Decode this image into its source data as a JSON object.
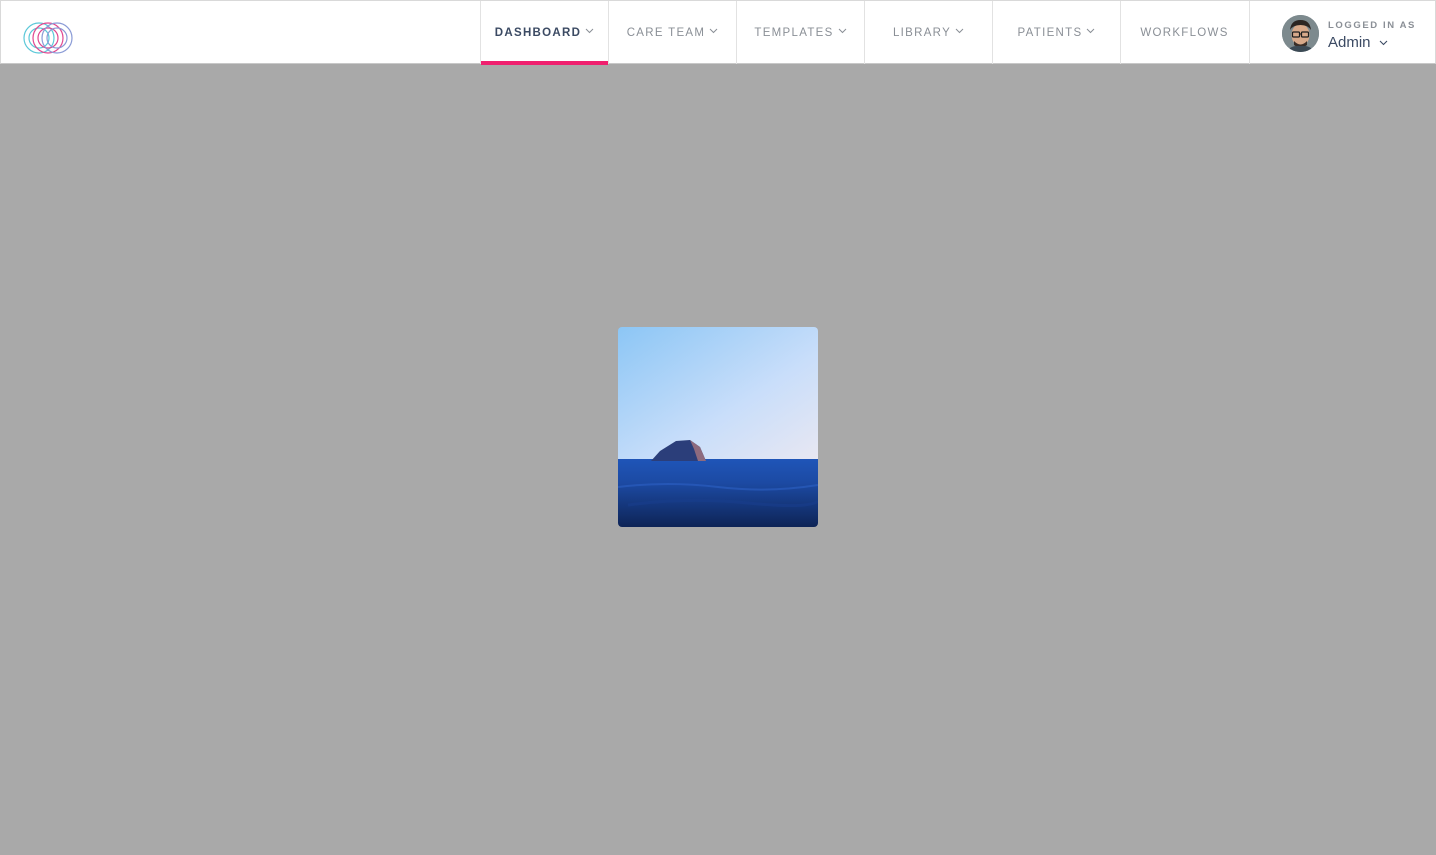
{
  "nav": {
    "items": [
      {
        "label": "DASHBOARD",
        "active": true,
        "dropdown": true
      },
      {
        "label": "CARE TEAM",
        "active": false,
        "dropdown": true
      },
      {
        "label": "TEMPLATES",
        "active": false,
        "dropdown": true
      },
      {
        "label": "LIBRARY",
        "active": false,
        "dropdown": true
      },
      {
        "label": "PATIENTS",
        "active": false,
        "dropdown": true
      },
      {
        "label": "WORKFLOWS",
        "active": false,
        "dropdown": false
      }
    ]
  },
  "user": {
    "caption": "LOGGED IN AS",
    "name": "Admin"
  },
  "colors": {
    "accent": "#ef1f6e",
    "background": "#a9a9a9",
    "nav_text": "#8a8f96",
    "active_text": "#3b4a63"
  },
  "icons": {
    "logo": "overlapping-circles-logo",
    "chevron": "chevron-down-icon",
    "photo": "island-seascape-image"
  }
}
